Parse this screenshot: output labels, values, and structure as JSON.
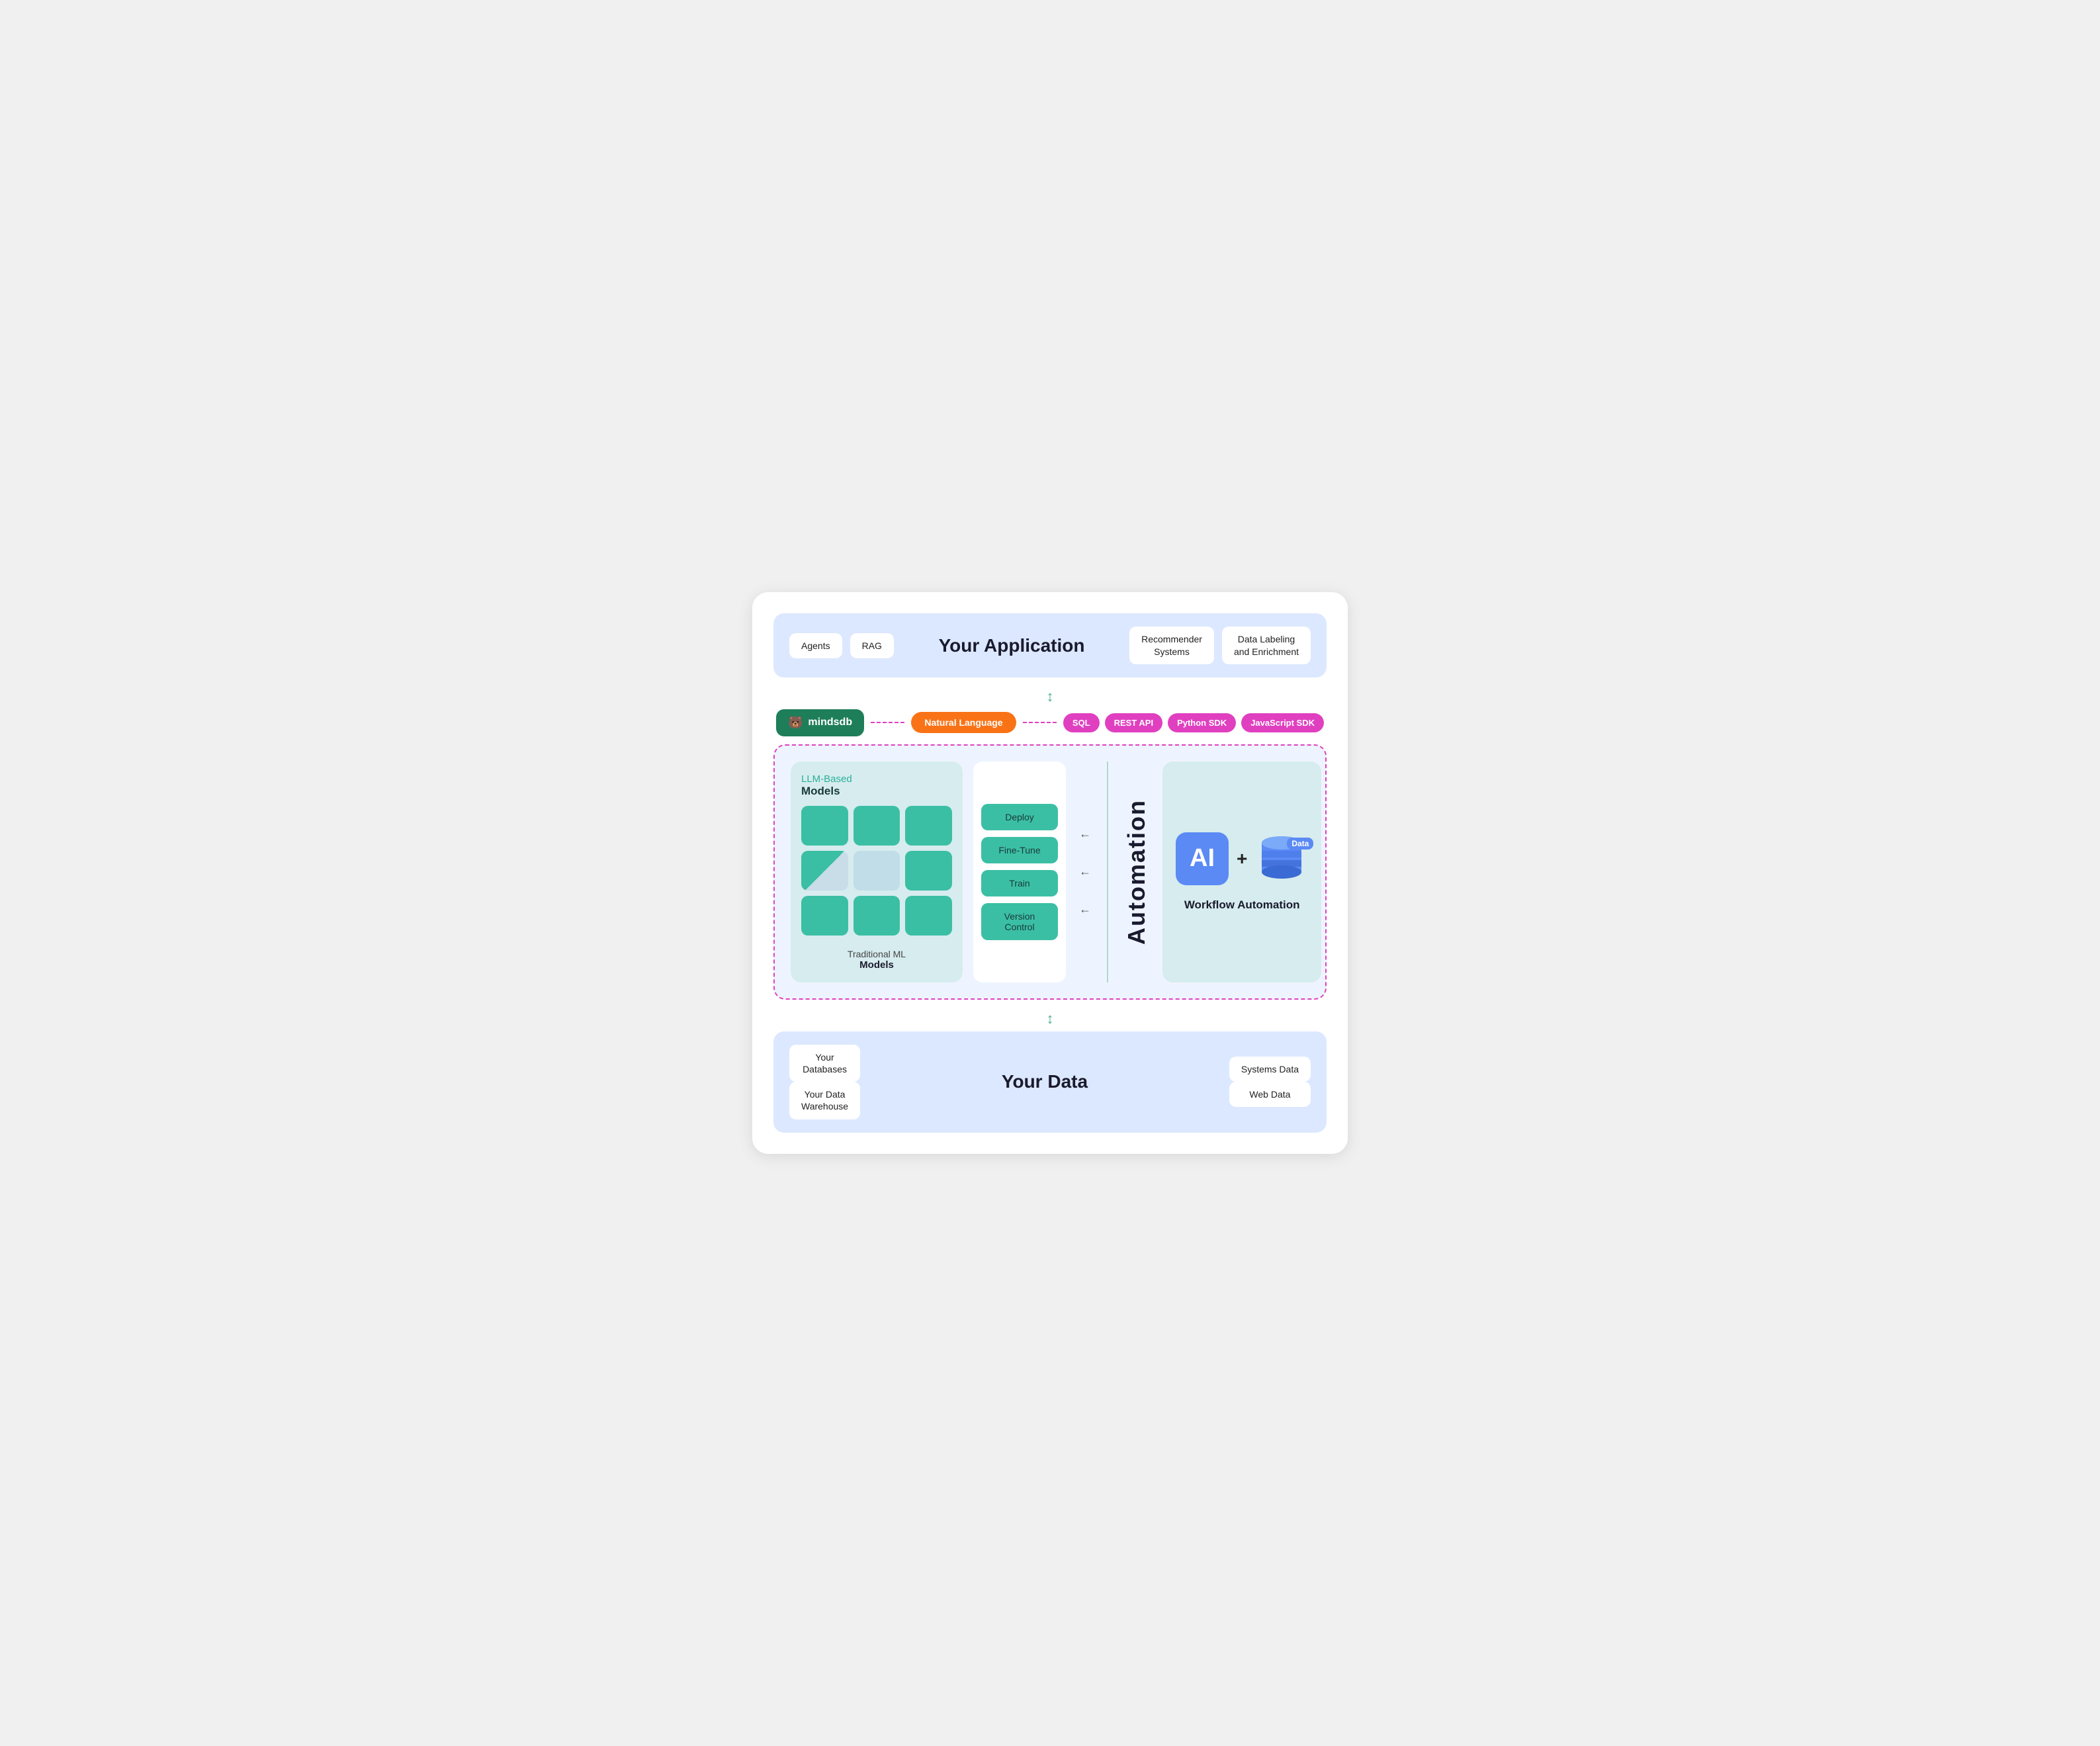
{
  "header": {
    "app_title": "Your Application",
    "top_left_boxes": [
      {
        "label": "Agents"
      },
      {
        "label": "RAG"
      }
    ],
    "top_right_boxes": [
      {
        "label": "Recommender\nSystems"
      },
      {
        "label": "Data Labeling\nand Enrichment"
      }
    ]
  },
  "interface": {
    "mindsdb_label": "mindsdb",
    "natural_language": "Natural Language",
    "arrow": "↕",
    "api_pills": [
      "SQL",
      "REST API",
      "Python SDK",
      "JavaScript SDK"
    ]
  },
  "models": {
    "llm_label": "LLM-Based",
    "llm_sublabel": "Models",
    "traditional_label": "Traditional ML",
    "traditional_sublabel": "Models"
  },
  "actions": {
    "buttons": [
      "Deploy",
      "Fine-Tune",
      "Train",
      "Version\nControl"
    ]
  },
  "automation": {
    "label": "Automation",
    "ai_label": "AI",
    "data_label": "Data",
    "plus": "+",
    "workflow_title": "Workflow Automation"
  },
  "footer": {
    "data_title": "Your Data",
    "boxes": [
      {
        "label": "Your\nDatabases"
      },
      {
        "label": "Your Data\nWarehouse"
      },
      {
        "label": "Systems Data"
      },
      {
        "label": "Web Data"
      }
    ]
  }
}
